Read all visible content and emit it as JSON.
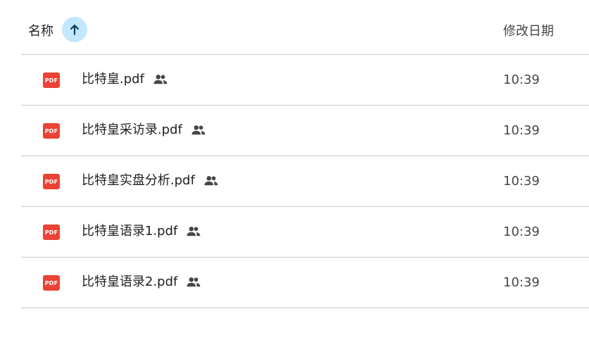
{
  "header": {
    "name_label": "名称",
    "modified_label": "修改日期",
    "sort_icon": "arrow-up-icon"
  },
  "colors": {
    "pdf_icon": "#ea4335",
    "sort_button_bg": "#c2e7ff",
    "sort_arrow": "#0b3e63",
    "divider": "#c7c7c7"
  },
  "files": [
    {
      "icon_text": "PDF",
      "name": "比特皇.pdf",
      "shared_icon": "people-icon",
      "modified": "10:39"
    },
    {
      "icon_text": "PDF",
      "name": "比特皇采访录.pdf",
      "shared_icon": "people-icon",
      "modified": "10:39"
    },
    {
      "icon_text": "PDF",
      "name": "比特皇实盘分析.pdf",
      "shared_icon": "people-icon",
      "modified": "10:39"
    },
    {
      "icon_text": "PDF",
      "name": "比特皇语录1.pdf",
      "shared_icon": "people-icon",
      "modified": "10:39"
    },
    {
      "icon_text": "PDF",
      "name": "比特皇语录2.pdf",
      "shared_icon": "people-icon",
      "modified": "10:39"
    }
  ]
}
